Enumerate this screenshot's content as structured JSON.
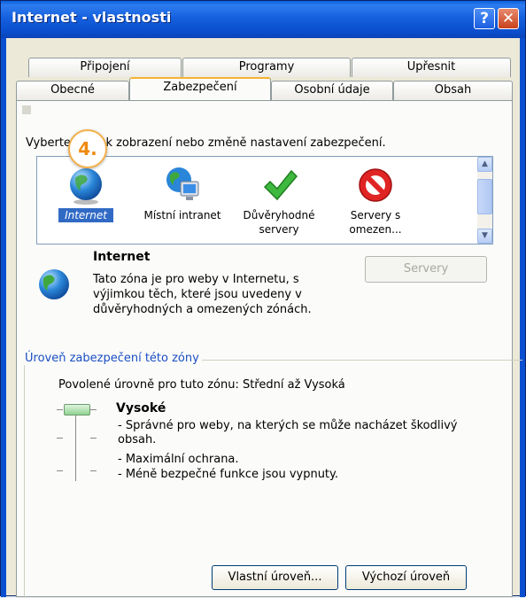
{
  "window": {
    "title": "Internet - vlastnosti",
    "help_glyph": "?",
    "close_glyph": "✕"
  },
  "tabs_row1": [
    "Připojení",
    "Programy",
    "Upřesnit"
  ],
  "tabs_row2": [
    "Obecné",
    "Zabezpečení",
    "Osobní údaje",
    "Obsah"
  ],
  "active_tab": "Zabezpečení",
  "instruction": "Vyberte zónu k zobrazení nebo změně nastavení zabezpečení.",
  "step_badge": "4.",
  "zones": [
    {
      "label": "Internet",
      "icon": "globe-icon",
      "selected": true
    },
    {
      "label": "Místní intranet",
      "icon": "intranet-icon",
      "selected": false
    },
    {
      "label": "Důvěryhodné servery",
      "icon": "checkmark-icon",
      "selected": false
    },
    {
      "label": "Servery s omezen...",
      "icon": "no-entry-icon",
      "selected": false
    }
  ],
  "zone_info": {
    "title": "Internet",
    "description": "Tato zóna je pro weby v Internetu, s výjimkou těch, které jsou uvedeny v důvěryhodných a omezených zónách.",
    "servers_button": "Servery"
  },
  "security_level": {
    "group_label": "Úroveň zabezpečení této zóny",
    "allowed": "Povolené úrovně pro tuto zónu: Střední až Vysoká",
    "level_name": "Vysoké",
    "bullets": [
      "- Správné pro weby, na kterých se může nacházet škodlivý obsah.",
      "- Maximální ochrana.",
      "- Méně bezpečné funkce jsou vypnuty."
    ],
    "slider_level": "Vysoké"
  },
  "buttons": {
    "custom_level": "Vlastní úroveň...",
    "default_level": "Výchozí úroveň"
  },
  "colors": {
    "title_bar": "#1560de",
    "selection": "#316ac5",
    "badge_orange": "#ee8a10"
  }
}
